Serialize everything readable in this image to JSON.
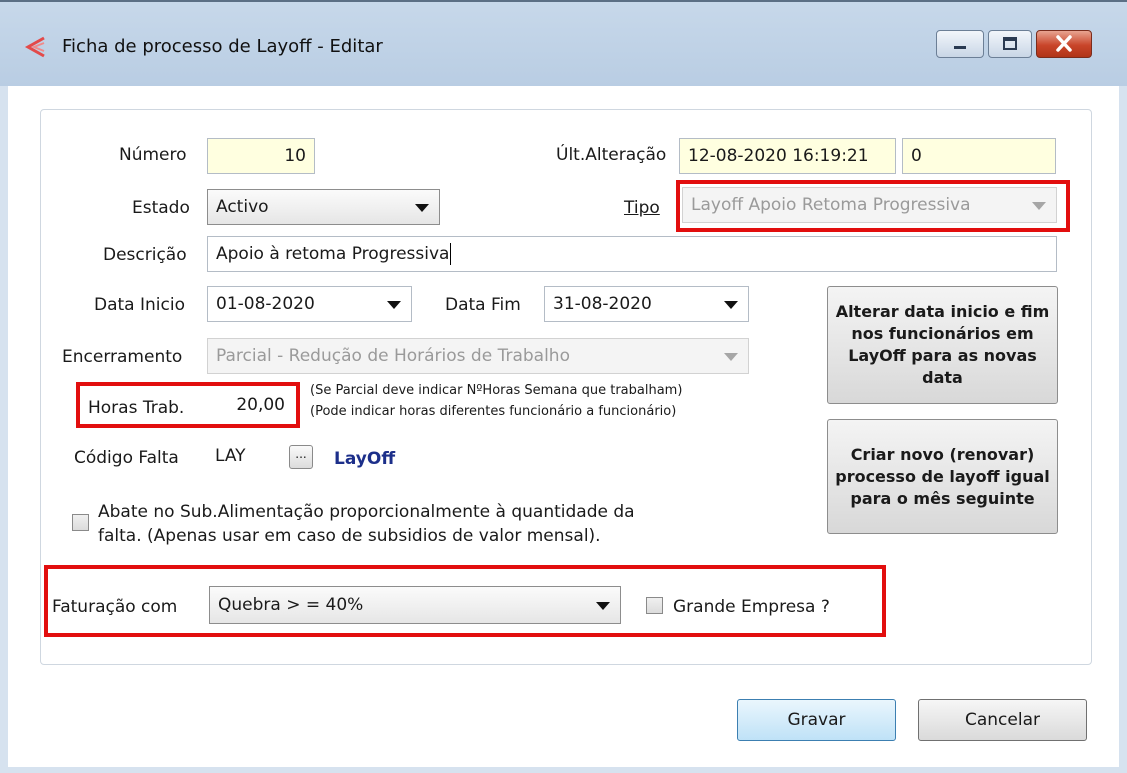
{
  "window": {
    "title": "Ficha de processo de Layoff - Editar"
  },
  "form": {
    "numero_label": "Número",
    "numero_value": "10",
    "ult_alteracao_label": "Últ.Alteração",
    "ult_alteracao_value": "12-08-2020 16:19:21",
    "ult_alteracao_extra": "0",
    "estado_label": "Estado",
    "estado_value": "Activo",
    "tipo_label": "Tipo",
    "tipo_value": "Layoff Apoio Retoma Progressiva",
    "descricao_label": "Descrição",
    "descricao_value": "Apoio à retoma Progressiva",
    "data_inicio_label": "Data Inicio",
    "data_inicio_value": "01-08-2020",
    "data_fim_label": "Data Fim",
    "data_fim_value": "31-08-2020",
    "encerramento_label": "Encerramento",
    "encerramento_value": "Parcial - Redução de  Horários de Trabalho",
    "horas_label": "Horas Trab.",
    "horas_value": "20,00",
    "horas_note_1": "(Se Parcial deve indicar NºHoras Semana que trabalham)",
    "horas_note_2": "(Pode indicar horas diferentes funcionário a funcionário)",
    "codigo_falta_label": "Código Falta",
    "codigo_falta_value": "LAY",
    "codigo_falta_lookup": "...",
    "codigo_falta_desc": "LayOff",
    "abate_label_1": "Abate no Sub.Alimentação proporcionalmente à quantidade da",
    "abate_label_2": "falta. (Apenas usar em caso de subsidios de valor mensal).",
    "faturacao_label": "Faturação com",
    "faturacao_value": "Quebra > = 40%",
    "grande_empresa_label": "Grande Empresa ?"
  },
  "side_buttons": {
    "alterar_label": "Alterar data inicio e fim nos funcionários em LayOff para as novas data",
    "criar_label": "Criar novo (renovar) processo de layoff igual para o mês seguinte"
  },
  "footer": {
    "gravar_label": "Gravar",
    "cancelar_label": "Cancelar"
  },
  "colors": {
    "highlight": "#e20e0e",
    "accent": "#1c2f8a"
  }
}
